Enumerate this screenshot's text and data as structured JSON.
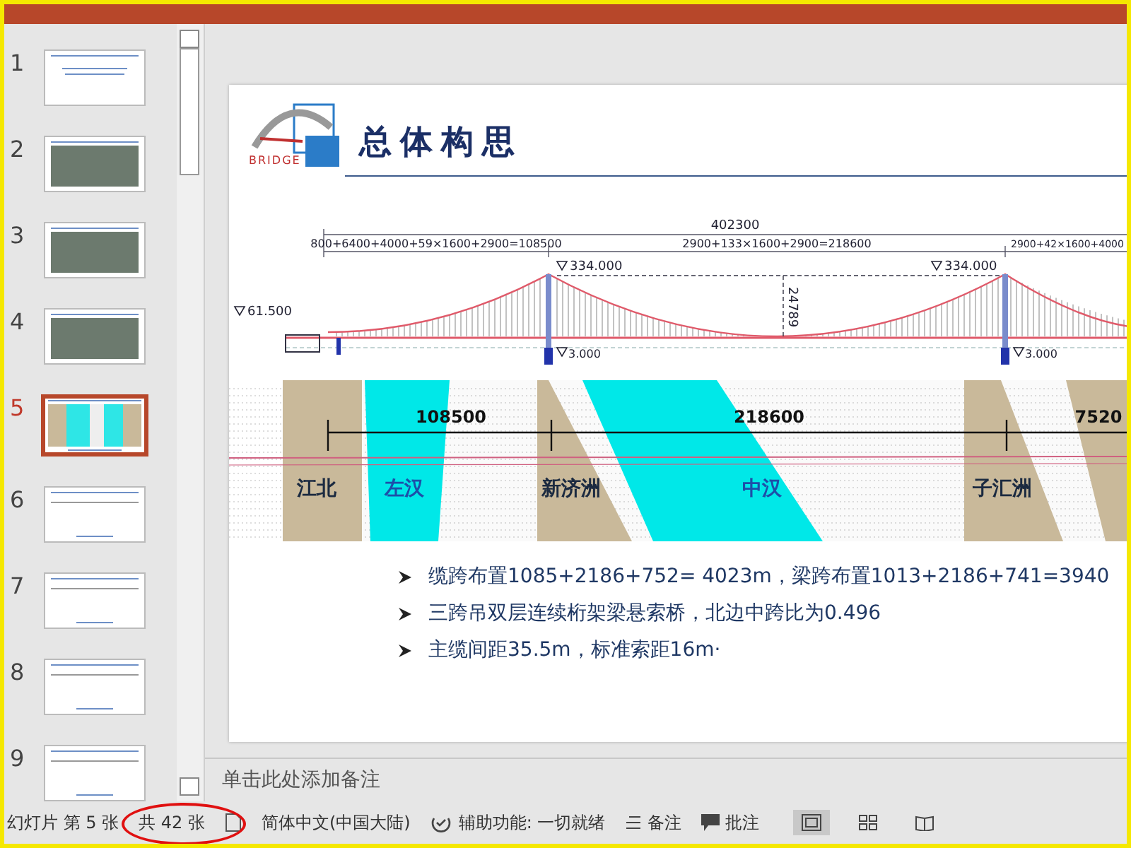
{
  "slides": [
    {
      "number": "1",
      "kind": "title",
      "selected": false
    },
    {
      "number": "2",
      "kind": "photo",
      "selected": false
    },
    {
      "number": "3",
      "kind": "photo",
      "selected": false
    },
    {
      "number": "4",
      "kind": "photo",
      "selected": false
    },
    {
      "number": "5",
      "kind": "plan",
      "selected": true
    },
    {
      "number": "6",
      "kind": "diagram",
      "selected": false
    },
    {
      "number": "7",
      "kind": "diagram",
      "selected": false
    },
    {
      "number": "8",
      "kind": "diagram",
      "selected": false
    },
    {
      "number": "9",
      "kind": "diagram",
      "selected": false
    }
  ],
  "slide": {
    "logo_text": "BRIDGE",
    "title": "总体构思",
    "elevation": {
      "total": "402300",
      "spans": [
        "800+6400+4000+59×1600+2900=108500",
        "2900+133×1600+2900=218600",
        "2900+42×1600+4000"
      ],
      "tower_levels": [
        "334.000",
        "334.000"
      ],
      "anchor_level": "61.500",
      "sag": "24789",
      "pier_levels": [
        "3.000",
        "3.000"
      ]
    },
    "plan": {
      "spans": [
        "108500",
        "218600",
        "7520"
      ],
      "places": [
        {
          "name": "江北",
          "kind": "bank"
        },
        {
          "name": "左汉",
          "kind": "channel"
        },
        {
          "name": "新济洲",
          "kind": "island"
        },
        {
          "name": "中汉",
          "kind": "channel"
        },
        {
          "name": "子汇洲",
          "kind": "island"
        }
      ]
    },
    "bullets": [
      "缆跨布置1085+2186+752= 4023m，梁跨布置1013+2186+741=3940",
      "三跨吊双层连续桁架梁悬索桥，北边中跨比为0.496",
      "主缆间距35.5m，标准索距16m·"
    ]
  },
  "notes": {
    "placeholder": "单击此处添加备注"
  },
  "status_bar": {
    "slide": "幻灯片 第 5 张",
    "count": "共 42 张",
    "language": "简体中文(中国大陆)",
    "accessibility": "辅助功能: 一切就绪",
    "notes_button": "备注",
    "comments_button": "批注",
    "views": [
      {
        "kind": "normal",
        "selected": true
      },
      {
        "kind": "sorter",
        "selected": false
      },
      {
        "kind": "reading",
        "selected": false
      }
    ]
  }
}
